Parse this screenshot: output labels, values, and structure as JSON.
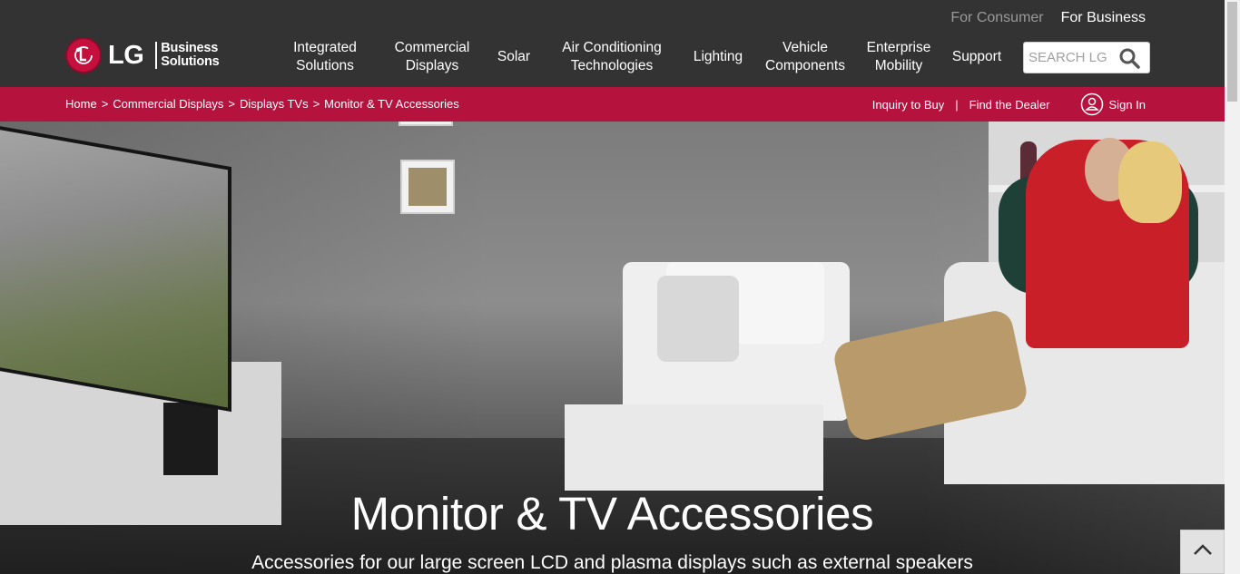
{
  "top_links": {
    "consumer": "For Consumer",
    "business": "For Business"
  },
  "logo": {
    "brand": "LG",
    "tagline_line1": "Business",
    "tagline_line2": "Solutions"
  },
  "nav": [
    {
      "line1": "Integrated",
      "line2": "Solutions"
    },
    {
      "line1": "Commercial",
      "line2": "Displays"
    },
    {
      "line1": "Solar",
      "line2": ""
    },
    {
      "line1": "Air Conditioning",
      "line2": "Technologies"
    },
    {
      "line1": "Lighting",
      "line2": ""
    },
    {
      "line1": "Vehicle",
      "line2": "Components"
    },
    {
      "line1": "Enterprise",
      "line2": "Mobility"
    },
    {
      "line1": "Support",
      "line2": ""
    }
  ],
  "search": {
    "placeholder": "SEARCH LG",
    "icon": "search-icon"
  },
  "breadcrumb": {
    "items": [
      "Home",
      "Commercial Displays",
      "Displays TVs",
      "Monitor & TV Accessories"
    ],
    "separator": ">"
  },
  "utility": {
    "inquiry": "Inquiry to Buy",
    "divider": "|",
    "dealer": "Find the Dealer",
    "signin": "Sign In"
  },
  "hero": {
    "title": "Monitor & TV Accessories",
    "subtitle": "Accessories for our large screen LCD and plasma displays such as external speakers"
  },
  "colors": {
    "header_bg": "#333333",
    "accent": "#b5123e",
    "brand_red": "#c5103e"
  }
}
